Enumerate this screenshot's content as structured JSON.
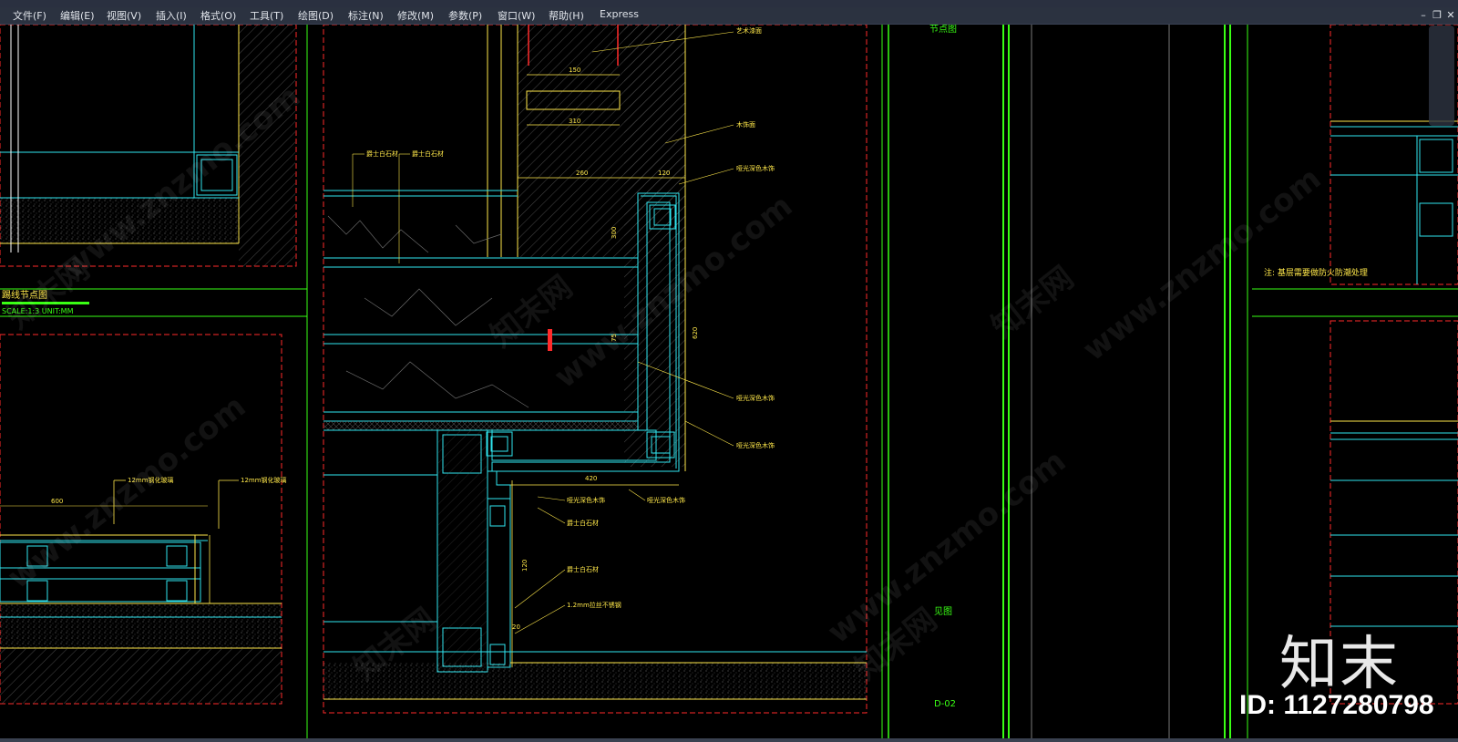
{
  "menubar": {
    "items": [
      "文件(F)",
      "编辑(E)",
      "视图(V)",
      "插入(I)",
      "格式(O)",
      "工具(T)",
      "绘图(D)",
      "标注(N)",
      "修改(M)",
      "参数(P)",
      "窗口(W)",
      "帮助(H)",
      "Express"
    ],
    "window_buttons": [
      "–",
      "❐",
      "✕"
    ]
  },
  "drawing": {
    "left_title": "踢线节点图",
    "left_scale": "SCALE:1:3  UNIT:MM",
    "node_label": "节点图",
    "elev_label": "见图",
    "sheet_code": "D-02",
    "note": "注: 基层需要做防火防潮处理",
    "callouts": {
      "art_paint": "艺术漆面",
      "jazz_stone_1": "爵士白石材",
      "jazz_stone_2": "爵士白石材",
      "mdf": "木饰面",
      "wood_veneer_1": "哑光深色木饰",
      "wood_veneer_2": "哑光深色木饰",
      "wood_veneer_3": "哑光深色木饰",
      "wood_veneer_4": "哑光深色木饰",
      "wood_veneer_5": "哑光深色木饰",
      "jazz_stone_3": "爵士白石材",
      "jazz_stone_4": "爵士白石材",
      "steel": "1.2mm拉丝不锈钢",
      "glass_1": "12mm钢化玻璃",
      "glass_2": "12mm钢化玻璃"
    },
    "dims": {
      "d150": "150",
      "d310": "310",
      "d260": "260",
      "d120": "120",
      "d300": "300",
      "d75": "75",
      "d620": "620",
      "d420": "420",
      "d120b": "120",
      "d600": "600",
      "d20": "20"
    }
  },
  "watermark": {
    "site": "www.znzmo.com",
    "cn": "知末网"
  },
  "brand": {
    "logo": "知末",
    "id": "ID: 1127280798"
  },
  "colors": {
    "background": "#000000",
    "cyan": "#2fe6f0",
    "yellow": "#ffe84a",
    "red": "#ff2a2a",
    "green": "#39ff14",
    "menubar": "#2b3240"
  }
}
